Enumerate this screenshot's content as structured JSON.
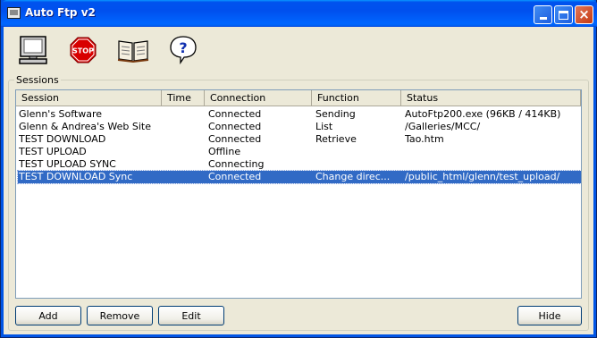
{
  "window": {
    "title": "Auto Ftp v2"
  },
  "toolbar": {
    "buttons": [
      {
        "icon": "monitor-icon"
      },
      {
        "icon": "stop-icon",
        "text": "STOP"
      },
      {
        "icon": "book-icon"
      },
      {
        "icon": "help-icon",
        "text": "?"
      }
    ]
  },
  "sessions": {
    "group_label": "Sessions",
    "columns": [
      "Session",
      "Time",
      "Connection",
      "Function",
      "Status"
    ],
    "rows": [
      {
        "session": "Glenn's Software",
        "time": "",
        "connection": "Connected",
        "function": "Sending",
        "status": "AutoFtp200.exe (96KB / 414KB)",
        "selected": false
      },
      {
        "session": "Glenn & Andrea's Web Site",
        "time": "",
        "connection": "Connected",
        "function": "List",
        "status": "/Galleries/MCC/",
        "selected": false
      },
      {
        "session": "TEST DOWNLOAD",
        "time": "",
        "connection": "Connected",
        "function": "Retrieve",
        "status": "Tao.htm",
        "selected": false
      },
      {
        "session": "TEST UPLOAD",
        "time": "",
        "connection": "Offline",
        "function": "",
        "status": "",
        "selected": false
      },
      {
        "session": "TEST UPLOAD SYNC",
        "time": "",
        "connection": "Connecting",
        "function": "",
        "status": "",
        "selected": false
      },
      {
        "session": "TEST DOWNLOAD Sync",
        "time": "",
        "connection": "Connected",
        "function": "Change direc...",
        "status": "/public_html/glenn/test_upload/",
        "selected": true
      }
    ]
  },
  "buttons": {
    "add": "Add",
    "remove": "Remove",
    "edit": "Edit",
    "hide": "Hide"
  },
  "colors": {
    "titlebar": "#0054e3",
    "selection": "#316ac5",
    "window_bg": "#ece9d8"
  }
}
